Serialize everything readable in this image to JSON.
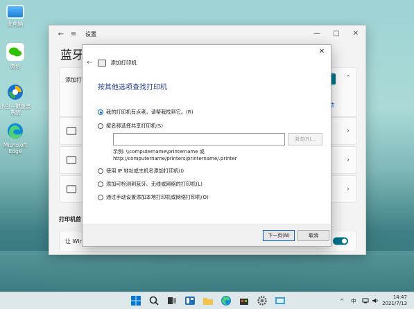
{
  "desktop": {
    "icons": [
      {
        "label": "此电脑",
        "icon": "computer-icon"
      },
      {
        "label": "微信",
        "icon": "wechat-icon"
      },
      {
        "label": "小白一键重装系统",
        "icon": "reinstall-icon"
      },
      {
        "label": "Microsoft Edge",
        "icon": "edge-icon"
      }
    ]
  },
  "settings": {
    "title": "设置",
    "page_title": "蓝牙",
    "card1_label": "添加打",
    "card1_link": "动",
    "section_label": "打印机首",
    "toggle_label": "让 Win",
    "window_buttons": [
      "—",
      "□",
      "✕"
    ]
  },
  "dialog": {
    "header": "添加打印机",
    "title": "按其他选项查找打印机",
    "options": [
      {
        "label": "我的打印机有点老。请帮我找到它。(R)",
        "selected": true
      },
      {
        "label": "按名称选择共享打印机(S)",
        "selected": false
      },
      {
        "label": "使用 IP 地址或主机名添加打印机(I)",
        "selected": false
      },
      {
        "label": "添加可检测到蓝牙、无线或网络的打印机(L)",
        "selected": false
      },
      {
        "label": "通过手动设置添加本地打印机或网络打印机(O)",
        "selected": false
      }
    ],
    "share_input_value": "",
    "browse_label": "浏览(R)...",
    "example_line1": "示例: \\\\computername\\printername 或",
    "example_line2": "http://computername/printers/printername/.printer",
    "next_label": "下一页(N)",
    "cancel_label": "取消",
    "close_label": "✕",
    "back_label": "←"
  },
  "taskbar": {
    "tray_chevron": "^",
    "ime": "中",
    "time": "14:47",
    "date": "2021/7/13"
  },
  "colors": {
    "accent": "#00748c",
    "link": "#1e3b8a"
  }
}
